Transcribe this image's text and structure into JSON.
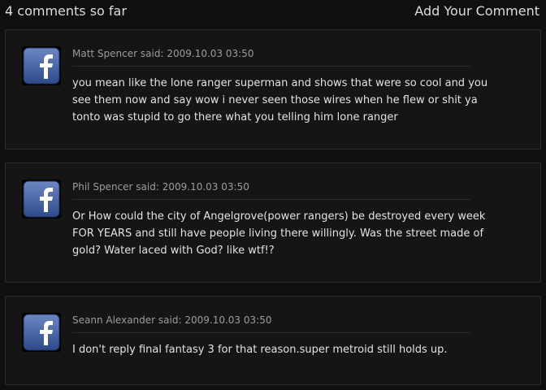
{
  "header": {
    "count_label": "4 comments so far",
    "add_label": "Add Your Comment"
  },
  "comments": [
    {
      "author": "Matt Spencer",
      "said": "said:",
      "date": "2009.10.03 03:50",
      "avatar_icon": "facebook-icon",
      "text": "you mean like the lone ranger superman and shows that were so cool and you see them now and say wow i never seen those wires when he flew or shit ya tonto was stupid to go there what you telling him lone ranger"
    },
    {
      "author": "Phil Spencer",
      "said": "said:",
      "date": "2009.10.03 03:50",
      "avatar_icon": "facebook-icon",
      "text": "Or How could the city of Angelgrove(power rangers) be destroyed every week FOR YEARS and still have people living there willingly. Was the street made of gold? Water laced with God? like wtf!?"
    },
    {
      "author": "Seann Alexander",
      "said": "said:",
      "date": "2009.10.03 03:50",
      "avatar_icon": "facebook-icon",
      "text": "I don't reply final fantasy 3 for that reason.super metroid still holds up."
    }
  ],
  "colors": {
    "background": "#0f0f0f",
    "card": "#151515",
    "facebook_blue": "#3b5998"
  }
}
